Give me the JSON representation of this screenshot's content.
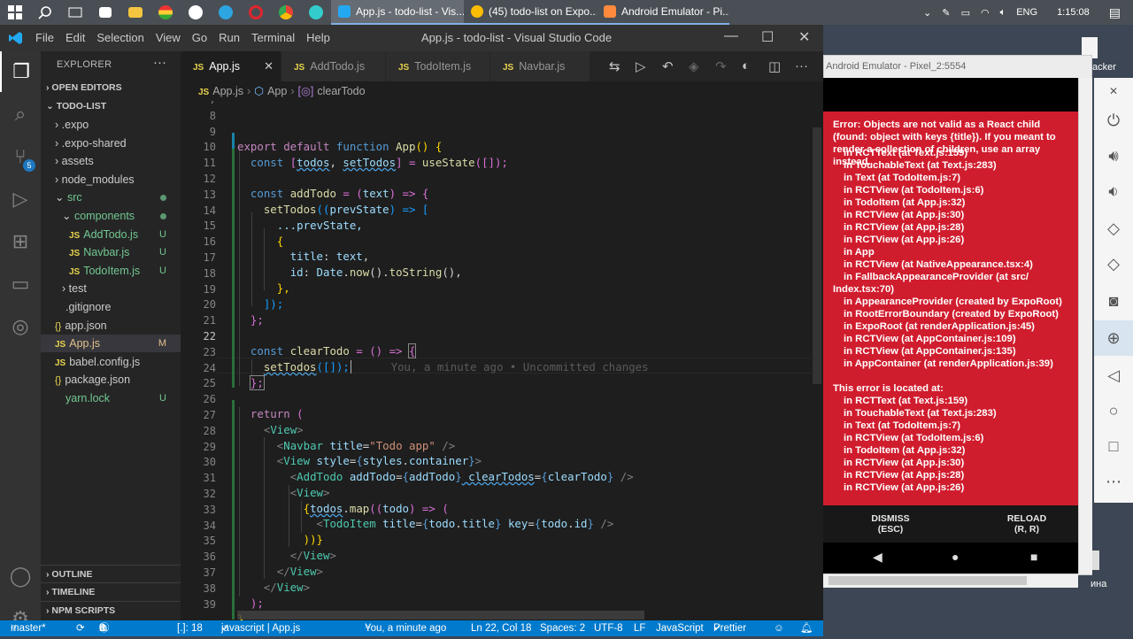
{
  "taskbar": {
    "tasks": [
      {
        "label": "App.js - todo-list - Vis...",
        "active": true
      },
      {
        "label": "(45) todo-list on Expo...",
        "active": false
      },
      {
        "label": "Android Emulator - Pi...",
        "active": false
      }
    ],
    "language": "ENG",
    "clock": "1:15:08"
  },
  "vscode": {
    "menu": [
      "File",
      "Edit",
      "Selection",
      "View",
      "Go",
      "Run",
      "Terminal",
      "Help"
    ],
    "window_title": "App.js - todo-list - Visual Studio Code",
    "explorer_title": "EXPLORER",
    "sections": {
      "open_editors": "OPEN EDITORS",
      "project": "TODO-LIST",
      "outline": "OUTLINE",
      "timeline": "TIMELINE",
      "npm_scripts": "NPM SCRIPTS"
    },
    "tree": [
      {
        "label": ".expo",
        "type": "folder",
        "status": ""
      },
      {
        "label": ".expo-shared",
        "type": "folder",
        "status": ""
      },
      {
        "label": "assets",
        "type": "folder",
        "status": ""
      },
      {
        "label": "node_modules",
        "type": "folder",
        "status": ""
      },
      {
        "label": "src",
        "type": "folder-open",
        "status": "dot"
      },
      {
        "label": "components",
        "type": "folder-open",
        "status": "dot"
      },
      {
        "label": "AddTodo.js",
        "type": "js",
        "status": "U"
      },
      {
        "label": "Navbar.js",
        "type": "js",
        "status": "U"
      },
      {
        "label": "TodoItem.js",
        "type": "js",
        "status": "U"
      },
      {
        "label": "test",
        "type": "folder",
        "status": ""
      },
      {
        "label": ".gitignore",
        "type": "file",
        "status": ""
      },
      {
        "label": "app.json",
        "type": "json",
        "status": ""
      },
      {
        "label": "App.js",
        "type": "js",
        "status": "M"
      },
      {
        "label": "babel.config.js",
        "type": "js",
        "status": ""
      },
      {
        "label": "package.json",
        "type": "json",
        "status": ""
      },
      {
        "label": "yarn.lock",
        "type": "file",
        "status": "U"
      }
    ],
    "source_control_badge": "5",
    "tabs": [
      "App.js",
      "AddTodo.js",
      "TodoItem.js",
      "Navbar.js"
    ],
    "breadcrumb": [
      "App.js",
      "App",
      "clearTodo"
    ],
    "line_numbers": [
      "7",
      "8",
      "9",
      "10",
      "11",
      "12",
      "13",
      "14",
      "15",
      "16",
      "17",
      "18",
      "19",
      "20",
      "21",
      "22",
      "23",
      "24",
      "25",
      "26",
      "27",
      "28",
      "29",
      "30",
      "31",
      "32",
      "33",
      "34",
      "35",
      "36",
      "37",
      "38",
      "39"
    ],
    "code": {
      "l8": [
        "export",
        " default ",
        "function",
        " App",
        "() {"
      ],
      "l9": [
        "const",
        " [",
        "todos",
        ", ",
        "setTodos",
        "] = ",
        "useState",
        "([]);"
      ],
      "l11": [
        "const",
        " addTodo",
        " = (",
        "text",
        ") => {"
      ],
      "l12": [
        "setTodos",
        "((",
        "prevState",
        ") => ["
      ],
      "l13": [
        "...prevState,"
      ],
      "l14": [
        "{"
      ],
      "l15": [
        "title",
        ": ",
        "text",
        ","
      ],
      "l16": [
        "id",
        ": ",
        "Date",
        ".",
        "now",
        "().",
        "toString",
        "(),"
      ],
      "l17": [
        "},"
      ],
      "l18": [
        "]);"
      ],
      "l19": [
        "};"
      ],
      "l21": [
        "const",
        " clearTodo",
        " = () => ",
        "{"
      ],
      "l22": [
        "setTodos",
        "([]);"
      ],
      "l22_blame": "You, a minute ago • Uncommitted changes",
      "l23": [
        "};"
      ],
      "l25": [
        "return",
        " ("
      ],
      "l26": [
        "<",
        "View",
        ">"
      ],
      "l27": [
        "<",
        "Navbar",
        " title",
        "=",
        "\"Todo app\"",
        " />"
      ],
      "l28": [
        "<",
        "View",
        " style",
        "=",
        "{",
        "styles",
        ".",
        "container",
        "}",
        ">"
      ],
      "l29": [
        "<",
        "AddTodo",
        " addTodo",
        "=",
        "{",
        "addTodo",
        "}",
        " clearTodos",
        "=",
        "{",
        "clearTodo",
        "}",
        " />"
      ],
      "l30": [
        "<",
        "View",
        ">"
      ],
      "l31": [
        "{",
        "todos",
        ".",
        "map",
        "((",
        "todo",
        ") => ("
      ],
      "l32": [
        "<",
        "TodoItem",
        " title",
        "=",
        "{",
        "todo",
        ".",
        "title",
        "}",
        " key",
        "=",
        "{",
        "todo",
        ".",
        "id",
        "}",
        " />"
      ],
      "l33": [
        "))}"
      ],
      "l34": [
        "</",
        "View",
        ">"
      ],
      "l35": [
        "</",
        "View",
        ">"
      ],
      "l36": [
        "</",
        "View",
        ">"
      ],
      "l37": [
        ");"
      ],
      "l38": [
        "}"
      ]
    },
    "status": {
      "branch": "master*",
      "errors": "0",
      "warnings": "0",
      "info": "8",
      "selection": "[.]: 18",
      "lang_mode_left": "javascript | App.js",
      "blame": "You, a minute ago",
      "cursor": "Ln 22, Col 18",
      "spaces": "Spaces: 2",
      "encoding": "UTF-8",
      "eol": "LF",
      "language": "JavaScript",
      "prettier": "Prettier"
    }
  },
  "emulator": {
    "title": "Android Emulator - Pixel_2:5554",
    "error_message": "Error: Objects are not valid as a React child (found: object with keys {title}). If you meant to render a collection of children, use an array instead.",
    "stack": [
      "in RCTText (at Text.js:159)",
      "in TouchableText (at Text.js:283)",
      "in Text (at TodoItem.js:7)",
      "in RCTView (at TodoItem.js:6)",
      "in TodoItem (at App.js:32)",
      "in RCTView (at App.js:30)",
      "in RCTView (at App.js:28)",
      "in RCTView (at App.js:26)",
      "in App",
      "in RCTView (at NativeAppearance.tsx:4)",
      "in FallbackAppearanceProvider (at src/",
      "Index.tsx:70)",
      "in AppearanceProvider (created by ExpoRoot)",
      "in RootErrorBoundary (created by ExpoRoot)",
      "in ExpoRoot (at renderApplication.js:45)",
      "in RCTView (at AppContainer.js:109)",
      "in RCTView (at AppContainer.js:135)",
      "in AppContainer (at renderApplication.js:39)"
    ],
    "located_title": "This error is located at:",
    "located_stack": [
      "in RCTText (at Text.js:159)",
      "in TouchableText (at Text.js:283)",
      "in Text (at TodoItem.js:7)",
      "in RCTView (at TodoItem.js:6)",
      "in TodoItem (at App.js:32)",
      "in RCTView (at App.js:30)",
      "in RCTView (at App.js:28)",
      "in RCTView (at App.js:26)"
    ],
    "dismiss": "DISMISS",
    "dismiss_key": "(ESC)",
    "reload": "RELOAD",
    "reload_key": "(R, R)"
  },
  "desktop": {
    "label_top": "acker",
    "label_bottom": "ина"
  },
  "colors": {
    "vscode_blue": "#007acc",
    "error_red": "#d01d2e",
    "editor_bg": "#1e1e1e"
  }
}
